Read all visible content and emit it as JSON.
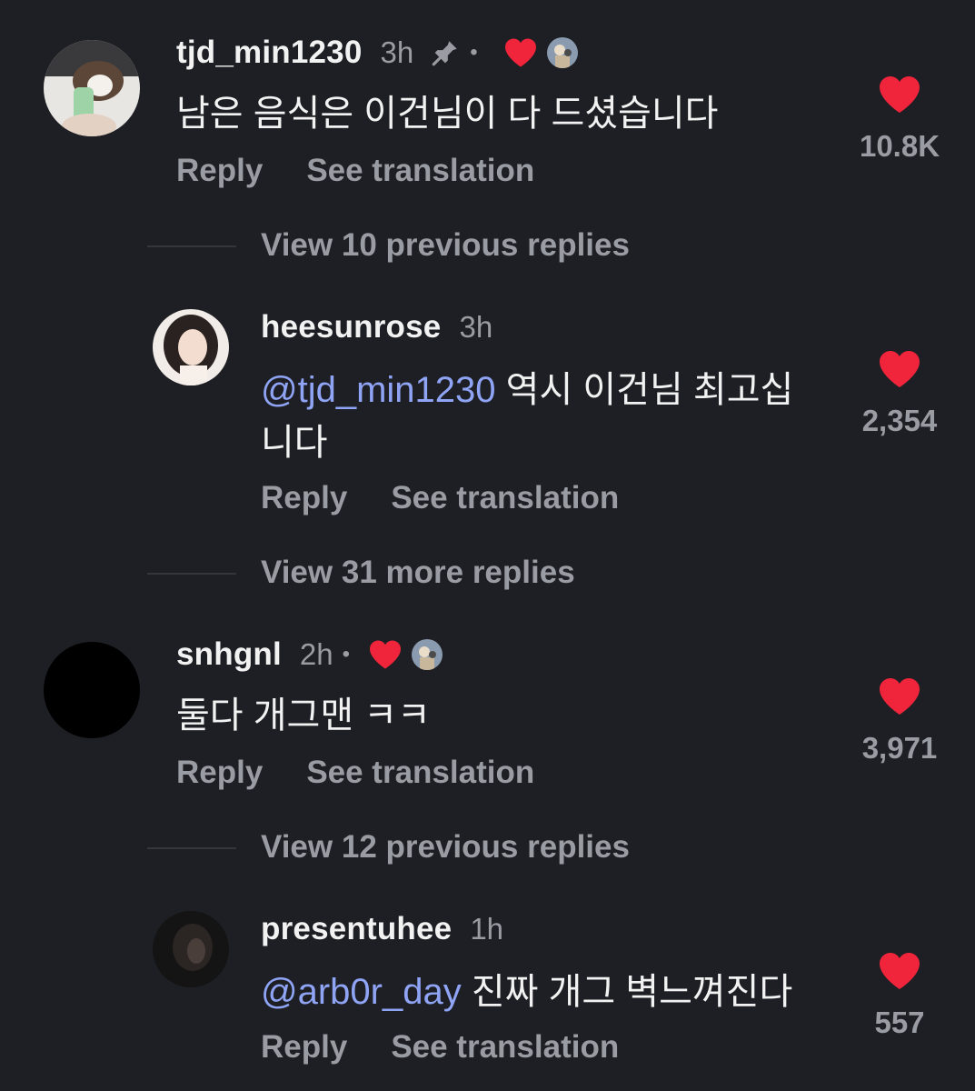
{
  "colors": {
    "background": "#1e1f24",
    "heart": "#f0243a",
    "mention": "#8fa4f5",
    "muted_text": "#9a9ca3"
  },
  "comments": [
    {
      "username": "tjd_min1230",
      "time": "3h",
      "pinned": true,
      "liked_by_creator": true,
      "text": "남은 음식은 이건님이 다 드셨습니다",
      "reply_label": "Reply",
      "translate_label": "See translation",
      "like_count": "10.8K",
      "icon": "heart-icon"
    },
    {
      "username": "heesunrose",
      "time": "3h",
      "mention": "@tjd_min1230",
      "text": "역시 이건님 최고십니다",
      "reply_label": "Reply",
      "translate_label": "See translation",
      "like_count": "2,354",
      "icon": "heart-icon"
    },
    {
      "username": "snhgnl",
      "time": "2h",
      "liked_by_creator": true,
      "text": "둘다 개그맨 ㅋㅋ",
      "reply_label": "Reply",
      "translate_label": "See translation",
      "like_count": "3,971",
      "icon": "heart-icon"
    },
    {
      "username": "presentuhee",
      "time": "1h",
      "mention": "@arb0r_day",
      "text": "진짜 개그 벽느껴진다",
      "reply_label": "Reply",
      "translate_label": "See translation",
      "like_count": "557",
      "icon": "heart-icon"
    }
  ],
  "reply_threads": [
    {
      "label": "View 10 previous replies"
    },
    {
      "label": "View 31 more replies"
    },
    {
      "label": "View 12 previous replies"
    }
  ],
  "icons": {
    "pin": "pin-icon",
    "heart": "heart-icon",
    "dot": "•"
  }
}
